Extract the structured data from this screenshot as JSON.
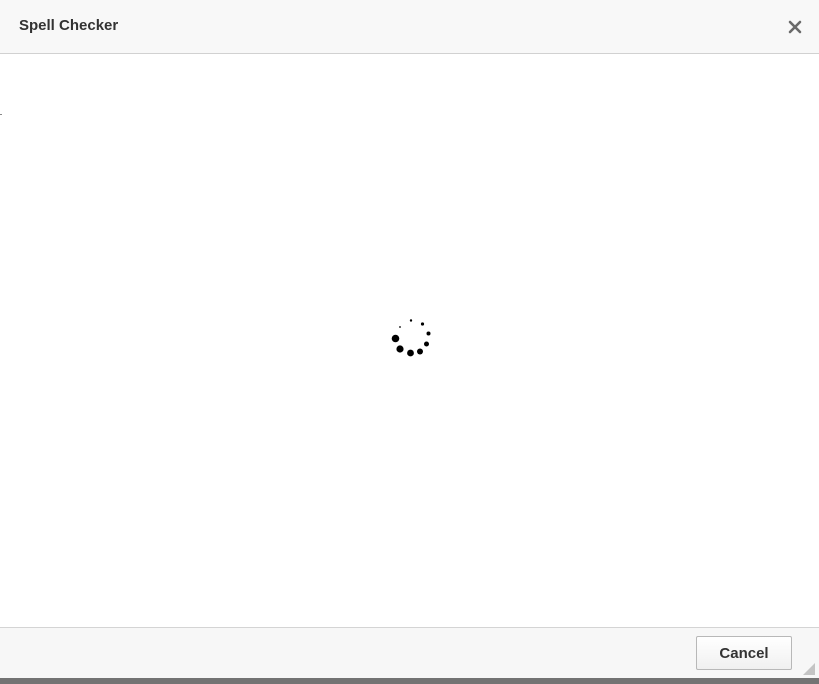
{
  "dialog": {
    "title": "Spell Checker",
    "close_icon": "close-icon",
    "loading_icon": "loading-spinner-icon"
  },
  "footer": {
    "cancel_label": "Cancel",
    "resize_icon": "resize-grip-icon"
  },
  "colors": {
    "titlebar_bg": "#f8f8f8",
    "footer_bg": "#f7f7f7",
    "title_text": "#333333",
    "bottom_bar": "#737373"
  }
}
